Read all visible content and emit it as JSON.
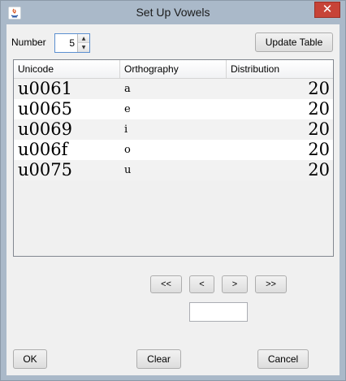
{
  "window": {
    "title": "Set Up Vowels",
    "close_label": "✕"
  },
  "controls": {
    "number_label": "Number",
    "number_value": "5",
    "update_button": "Update Table"
  },
  "table": {
    "columns": [
      "Unicode",
      "Orthography",
      "Distribution"
    ],
    "rows": [
      {
        "unicode": "u0061",
        "orthography": "a",
        "distribution": "20"
      },
      {
        "unicode": "u0065",
        "orthography": "e",
        "distribution": "20"
      },
      {
        "unicode": "u0069",
        "orthography": "i",
        "distribution": "20"
      },
      {
        "unicode": "u006f",
        "orthography": "o",
        "distribution": "20"
      },
      {
        "unicode": "u0075",
        "orthography": "u",
        "distribution": "20"
      }
    ]
  },
  "pagination": {
    "first": "<<",
    "prev": "<",
    "next": ">",
    "last": ">>",
    "page_value": ""
  },
  "footer": {
    "ok": "OK",
    "clear": "Clear",
    "cancel": "Cancel"
  }
}
